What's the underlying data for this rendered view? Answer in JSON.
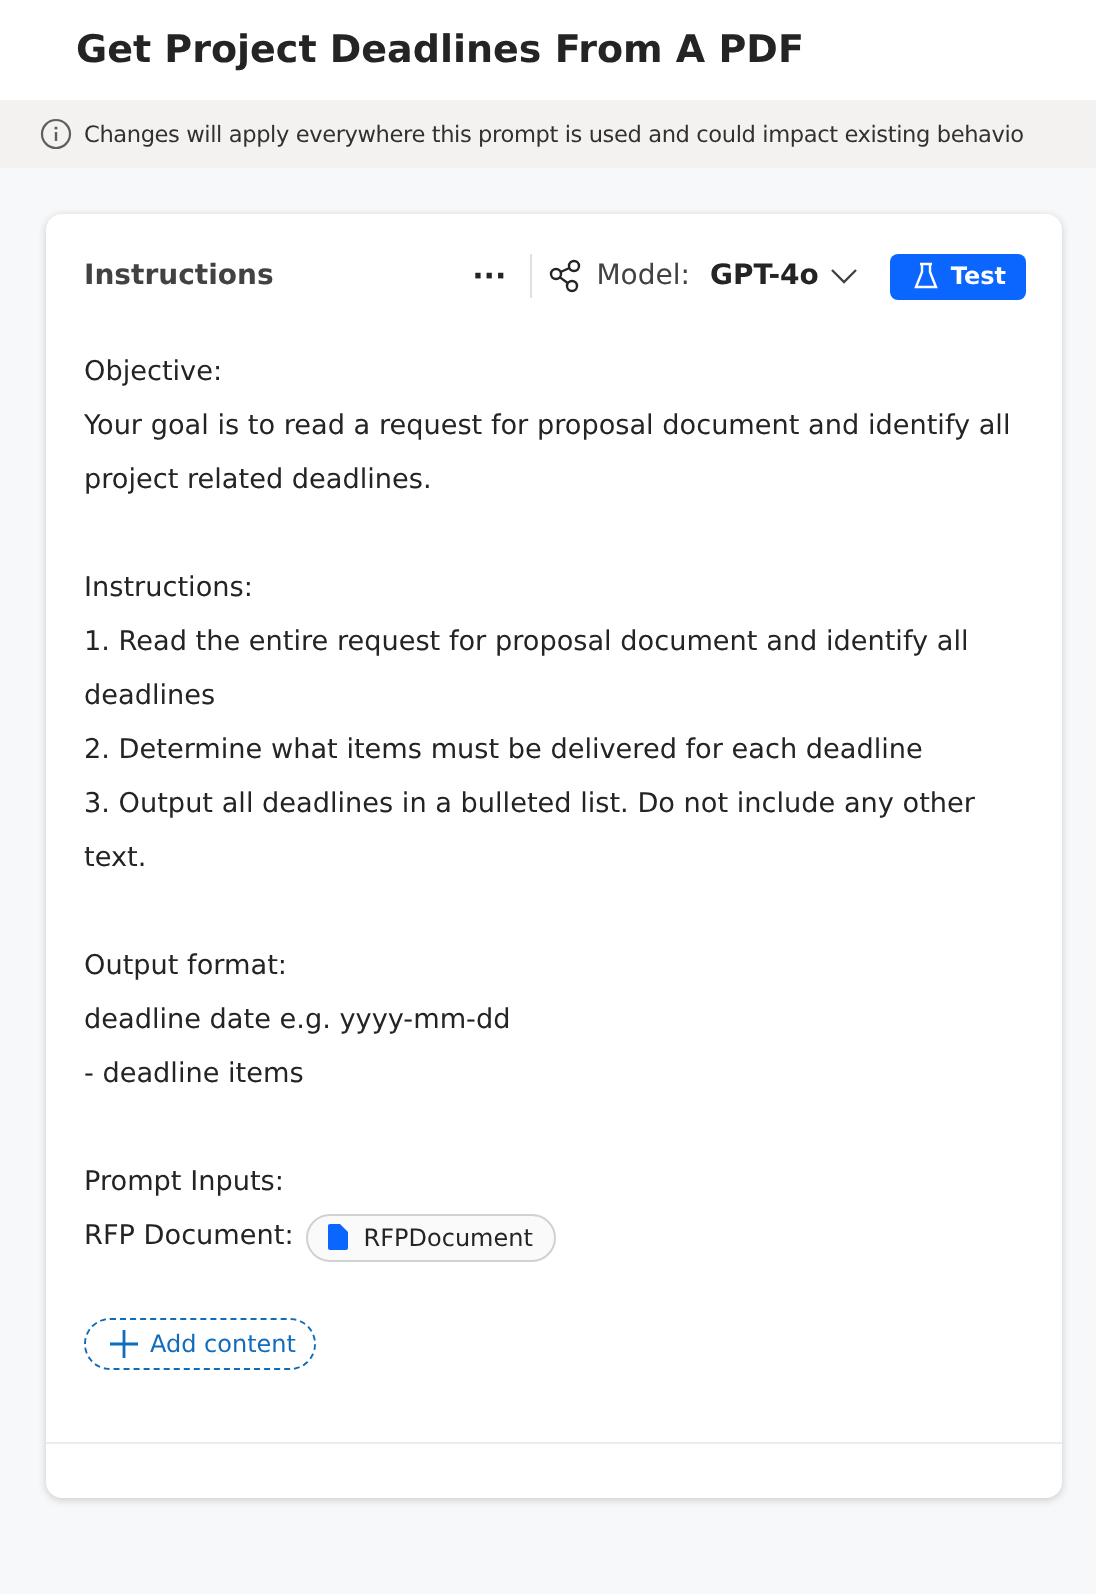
{
  "page_title": "Get Project Deadlines From A PDF",
  "notice": {
    "text": "Changes will apply everywhere this prompt is used and could impact existing behavio"
  },
  "card": {
    "title": "Instructions",
    "more": "···",
    "model_label": "Model:",
    "model_value": "GPT-4o",
    "test_button": "Test",
    "blocks": [
      {
        "lines": [
          "Objective:",
          "Your goal is to read a request for proposal document and identify all project related deadlines."
        ]
      },
      {
        "lines": [
          "Instructions:",
          "1. Read the entire request for proposal document and identify all deadlines",
          "2. Determine what items must be delivered for each deadline",
          "3. Output all deadlines in a bulleted list. Do not include any other text."
        ]
      },
      {
        "lines": [
          "Output format:",
          "deadline date e.g. yyyy-mm-dd",
          "- deadline items"
        ]
      },
      {
        "lines": [
          "Prompt Inputs:"
        ],
        "input": {
          "label": "RFP Document:",
          "chip": "RFPDocument"
        }
      }
    ],
    "add_button": "Add content"
  }
}
